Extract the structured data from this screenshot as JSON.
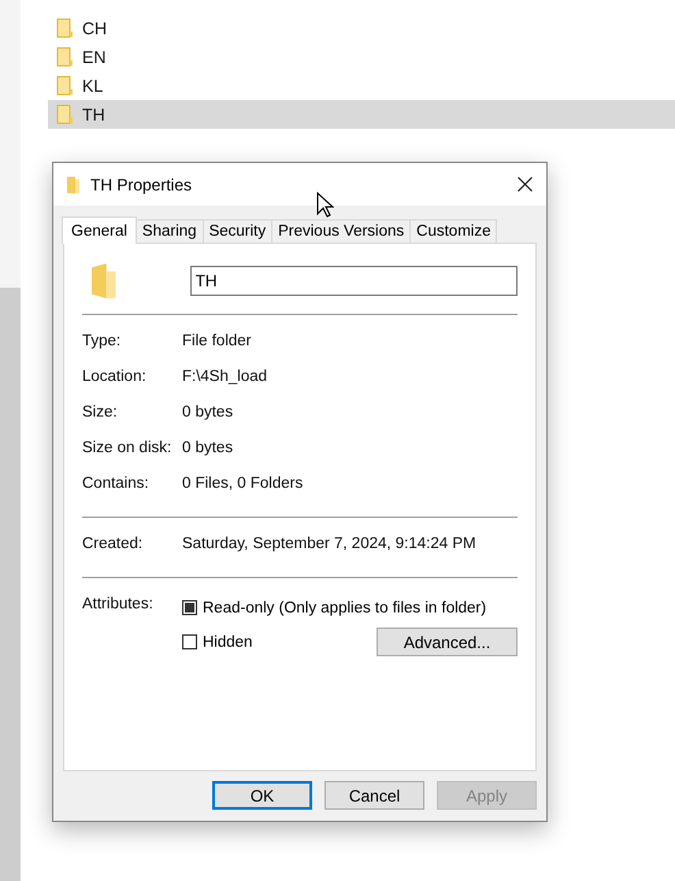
{
  "folders": [
    {
      "name": "CH",
      "selected": false
    },
    {
      "name": "EN",
      "selected": false
    },
    {
      "name": "KL",
      "selected": false
    },
    {
      "name": "TH",
      "selected": true
    }
  ],
  "dialog": {
    "title": "TH Properties",
    "tabs": [
      {
        "label": "General",
        "selected": true
      },
      {
        "label": "Sharing",
        "selected": false
      },
      {
        "label": "Security",
        "selected": false
      },
      {
        "label": "Previous Versions",
        "selected": false
      },
      {
        "label": "Customize",
        "selected": false
      }
    ],
    "name_value": "TH",
    "info_groups": [
      [
        {
          "label": "Type:",
          "value": "File folder"
        },
        {
          "label": "Location:",
          "value": "F:\\4Sh_load"
        },
        {
          "label": "Size:",
          "value": "0 bytes"
        },
        {
          "label": "Size on disk:",
          "value": "0 bytes"
        },
        {
          "label": "Contains:",
          "value": "0 Files, 0 Folders"
        }
      ],
      [
        {
          "label": "Created:",
          "value": "Saturday, September 7, 2024, 9:14:24 PM"
        }
      ]
    ],
    "attributes_label": "Attributes:",
    "attributes": [
      {
        "label": "Read-only (Only applies to files in folder)",
        "checked": false,
        "indeterminate": true
      },
      {
        "label": "Hidden",
        "checked": false,
        "indeterminate": false
      }
    ],
    "advanced_button": "Advanced...",
    "buttons": [
      {
        "label": "OK",
        "focused": true,
        "disabled": false
      },
      {
        "label": "Cancel",
        "focused": false,
        "disabled": false
      },
      {
        "label": "Apply",
        "focused": false,
        "disabled": true
      }
    ]
  }
}
